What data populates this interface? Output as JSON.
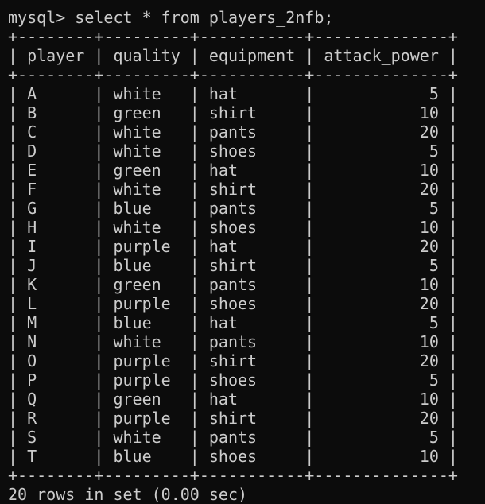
{
  "terminal": {
    "prompt": "mysql>",
    "command": "select * from players_2nfb;",
    "footer": "20 rows in set (0.00 sec)"
  },
  "table": {
    "columns": [
      "player",
      "quality",
      "equipment",
      "attack_power"
    ],
    "widths": [
      8,
      9,
      11,
      14
    ],
    "align": [
      "left",
      "left",
      "left",
      "right"
    ],
    "rows": [
      [
        "A",
        "white",
        "hat",
        "5"
      ],
      [
        "B",
        "green",
        "shirt",
        "10"
      ],
      [
        "C",
        "white",
        "pants",
        "20"
      ],
      [
        "D",
        "white",
        "shoes",
        "5"
      ],
      [
        "E",
        "green",
        "hat",
        "10"
      ],
      [
        "F",
        "white",
        "shirt",
        "20"
      ],
      [
        "G",
        "blue",
        "pants",
        "5"
      ],
      [
        "H",
        "white",
        "shoes",
        "10"
      ],
      [
        "I",
        "purple",
        "hat",
        "20"
      ],
      [
        "J",
        "blue",
        "shirt",
        "5"
      ],
      [
        "K",
        "green",
        "pants",
        "10"
      ],
      [
        "L",
        "purple",
        "shoes",
        "20"
      ],
      [
        "M",
        "blue",
        "hat",
        "5"
      ],
      [
        "N",
        "white",
        "pants",
        "10"
      ],
      [
        "O",
        "purple",
        "shirt",
        "20"
      ],
      [
        "P",
        "purple",
        "shoes",
        "5"
      ],
      [
        "Q",
        "green",
        "hat",
        "10"
      ],
      [
        "R",
        "purple",
        "shirt",
        "20"
      ],
      [
        "S",
        "white",
        "pants",
        "5"
      ],
      [
        "T",
        "blue",
        "shoes",
        "10"
      ]
    ]
  },
  "colors": {
    "background": "#0c0c0c",
    "text": "#cccccc"
  }
}
